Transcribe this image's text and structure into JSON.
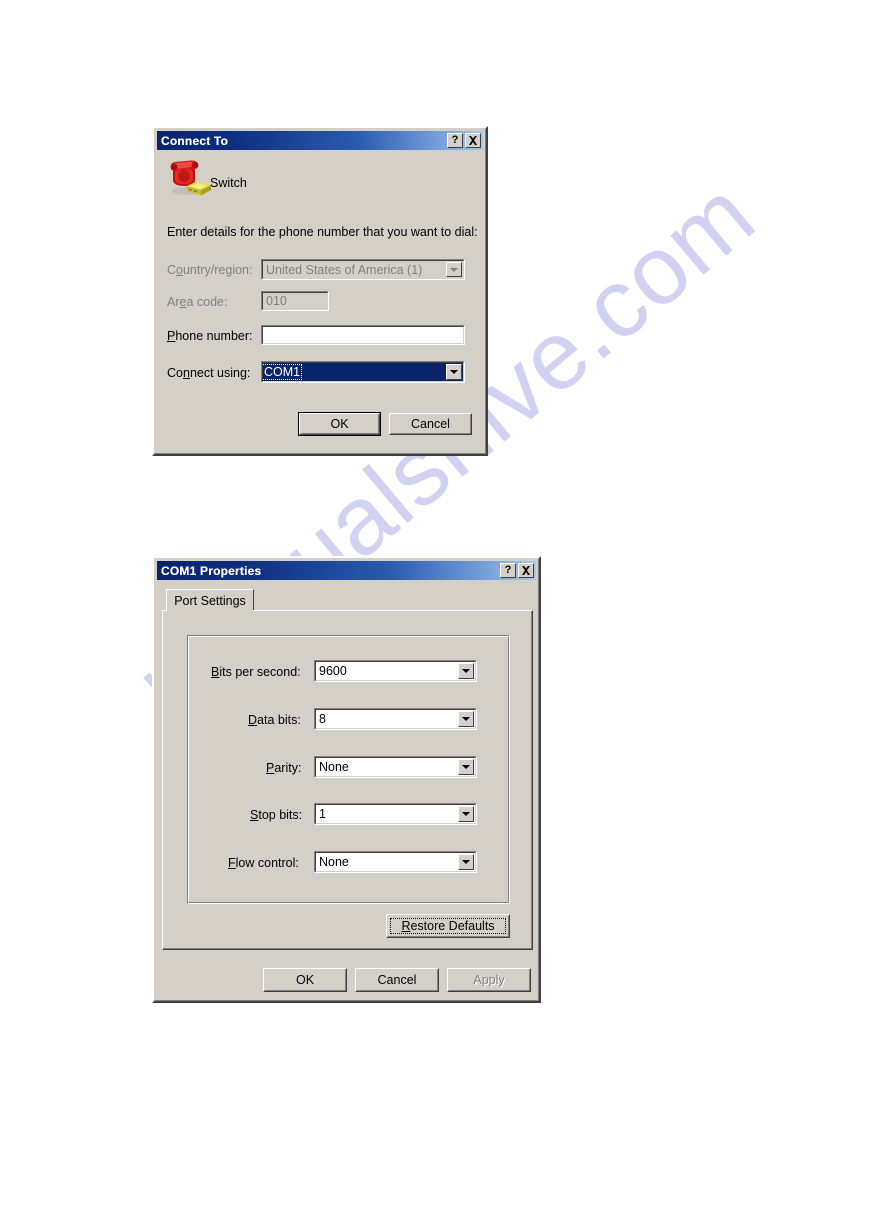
{
  "page": {
    "background_color": "#ffffff",
    "watermark_text": "manualshive.com",
    "watermark_color": "#c9c9ef"
  },
  "connect_to_dialog": {
    "title": "Connect To",
    "titlebar_buttons": [
      {
        "name": "help",
        "glyph": "?"
      },
      {
        "name": "close",
        "glyph": "×"
      }
    ],
    "icon_name": "phone-modem-icon",
    "connection_name": "Switch",
    "instruction": "Enter details for the phone number that you want to dial:",
    "fields": [
      {
        "label": "Country/region:",
        "label_pre": "C",
        "label_mnemonic": "o",
        "label_post": "untry/region:",
        "value": "United States of America (1)",
        "type": "combobox",
        "disabled": true,
        "selected": false
      },
      {
        "label": "Area code:",
        "label_pre": "Ar",
        "label_mnemonic": "e",
        "label_post": "a code:",
        "value": "010",
        "type": "textbox",
        "disabled": true,
        "selected": false
      },
      {
        "label": "Phone number:",
        "label_pre": "",
        "label_mnemonic": "P",
        "label_post": "hone number:",
        "value": "",
        "type": "textbox",
        "disabled": false,
        "selected": false
      },
      {
        "label": "Connect using:",
        "label_pre": "Co",
        "label_mnemonic": "n",
        "label_post": "nect using:",
        "value": "COM1",
        "type": "combobox",
        "disabled": false,
        "selected": true
      }
    ],
    "buttons": [
      {
        "label": "OK",
        "default": true,
        "disabled": false
      },
      {
        "label": "Cancel",
        "default": false,
        "disabled": false
      }
    ]
  },
  "com1_properties_dialog": {
    "title": "COM1 Properties",
    "titlebar_buttons": [
      {
        "name": "help",
        "glyph": "?"
      },
      {
        "name": "close",
        "glyph": "×"
      }
    ],
    "tabs": [
      {
        "label": "Port Settings",
        "active": true
      }
    ],
    "settings": [
      {
        "label": "Bits per second:",
        "label_pre": "",
        "label_mnemonic": "B",
        "label_post": "its per second:",
        "value": "9600"
      },
      {
        "label": "Data bits:",
        "label_pre": "",
        "label_mnemonic": "D",
        "label_post": "ata bits:",
        "value": "8"
      },
      {
        "label": "Parity:",
        "label_pre": "",
        "label_mnemonic": "P",
        "label_post": "arity:",
        "value": "None"
      },
      {
        "label": "Stop bits:",
        "label_pre": "",
        "label_mnemonic": "S",
        "label_post": "top bits:",
        "value": "1"
      },
      {
        "label": "Flow control:",
        "label_pre": "",
        "label_mnemonic": "F",
        "label_post": "low control:",
        "value": "None"
      }
    ],
    "restore_button": {
      "label": "Restore Defaults",
      "label_pre": "",
      "label_mnemonic": "R",
      "label_post": "estore Defaults",
      "focused": true
    },
    "buttons": [
      {
        "label": "OK",
        "default": false,
        "disabled": false
      },
      {
        "label": "Cancel",
        "default": false,
        "disabled": false
      },
      {
        "label": "Apply",
        "default": false,
        "disabled": true
      }
    ]
  }
}
